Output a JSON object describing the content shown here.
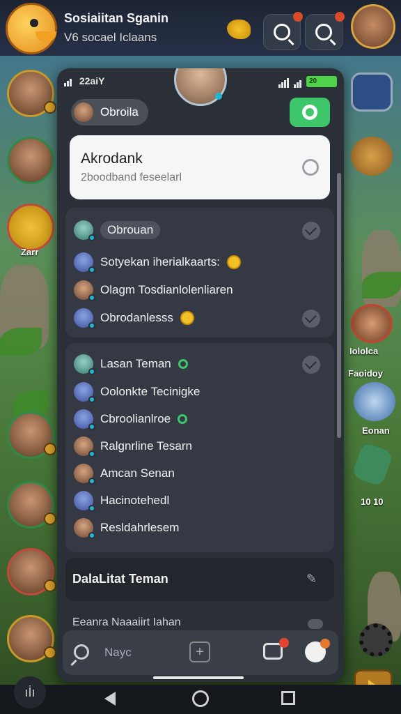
{
  "game": {
    "title": "Sosiaiitan Sganin",
    "subtitle": "V6 socael Iclaans"
  },
  "side_labels": {
    "left_badge": "Zarr",
    "right_1": "Iololca",
    "right_2": "Faoidoy",
    "right_3": "Eonan",
    "right_4": "10 10"
  },
  "status": {
    "time": "22aiY",
    "battery": "20"
  },
  "panel": {
    "profile_chip": "Obroila",
    "input_title": "Akrodank",
    "input_placeholder": "2boodband feseelarl",
    "group1": [
      {
        "label": "Obrouan",
        "avatar": "teal",
        "highlight": true
      },
      {
        "label": "Sotyekan iherialkaarts:",
        "avatar": "blue",
        "emoji": true
      },
      {
        "label": "Olagm Tosdianlolenliaren",
        "avatar": "tan"
      },
      {
        "label": "Obrodanlesss",
        "avatar": "blue",
        "emoji": true
      }
    ],
    "group2": [
      {
        "label": "Lasan Teman",
        "avatar": "teal",
        "status_dot": true
      },
      {
        "label": "Oolonkte Tecinigke",
        "avatar": "blue"
      },
      {
        "label": "Cbroolianlroe",
        "avatar": "blue",
        "status_dot": true
      },
      {
        "label": "Ralgnrline Tesarn",
        "avatar": "tan"
      },
      {
        "label": "Amcan Senan",
        "avatar": "tan"
      },
      {
        "label": "Hacinotehedl",
        "avatar": "blue"
      },
      {
        "label": "Resldahrlesem",
        "avatar": "tan"
      }
    ],
    "friendlist_label": "DalaLitat Teman",
    "peek_label": "Eeanra Naaaiirt Iahan"
  },
  "bottombar": {
    "nav_label": "Nayc",
    "add_symbol": "+"
  },
  "sysnav": {
    "left_symbol": "ıİı"
  },
  "colors": {
    "panel_bg": "#2b2f37",
    "group_bg": "#353943",
    "accent_green": "#3ec66a",
    "badge_red": "#e5452e"
  }
}
